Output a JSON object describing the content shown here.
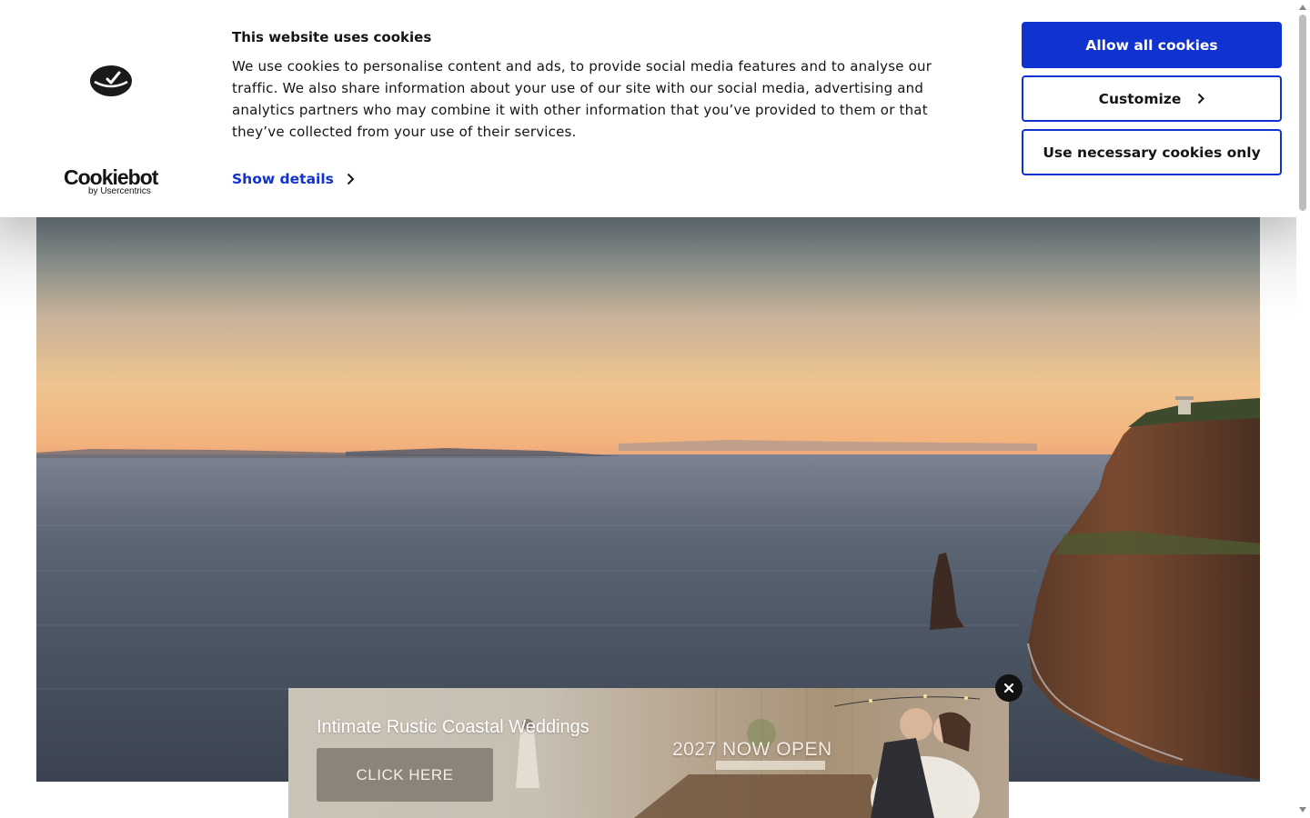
{
  "cookie_banner": {
    "logo_wordmark": "Cookiebot",
    "logo_sub": "by Usercentrics",
    "title": "This website uses cookies",
    "body": "We use cookies to personalise content and ads, to provide social media features and to analyse our traffic. We also share information about your use of our site with our social media, advertising and analytics partners who may combine it with other information that you’ve provided to them or that they’ve collected from your use of their services.",
    "show_details": "Show details",
    "buttons": {
      "allow_all": "Allow all cookies",
      "customize": "Customize",
      "necessary_only": "Use necessary cookies only"
    },
    "accent_color": "#1032cf"
  },
  "promo": {
    "title": "Intimate Rustic Coastal Weddings",
    "cta": "CLICK HERE",
    "badge": "2027 NOW OPEN"
  },
  "icons": {
    "close": "close-icon",
    "chevron": "chevron-right-icon"
  }
}
